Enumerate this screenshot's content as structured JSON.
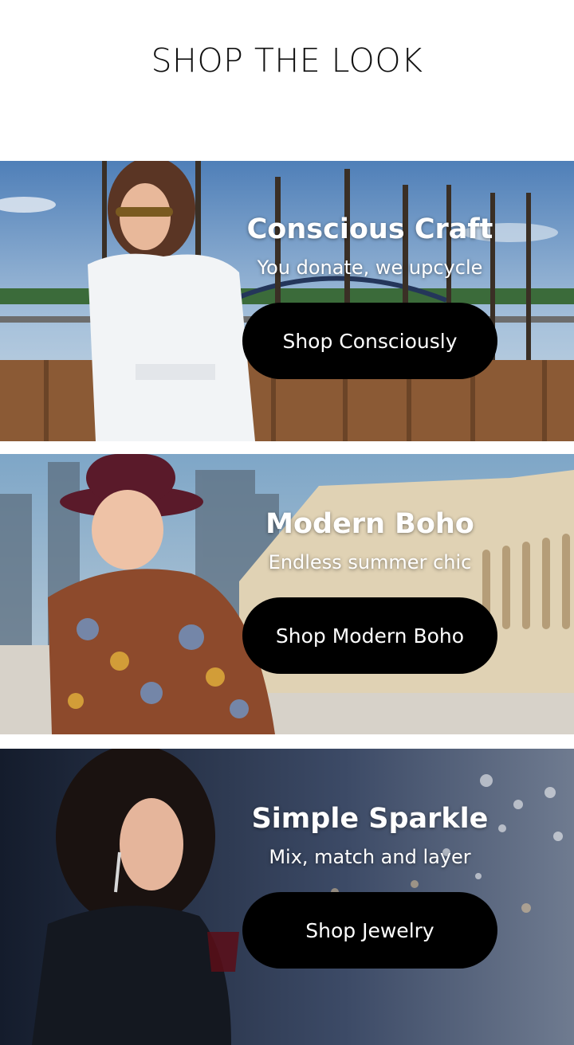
{
  "page": {
    "title": "SHOP THE LOOK"
  },
  "cards": [
    {
      "title": "Conscious Craft",
      "subtitle": "You donate, we upcycle",
      "button": "Shop Consciously"
    },
    {
      "title": "Modern Boho",
      "subtitle": "Endless summer chic",
      "button": "Shop Modern Boho"
    },
    {
      "title": "Simple Sparkle",
      "subtitle": "Mix, match and layer",
      "button": "Shop Jewelry"
    }
  ],
  "colors": {
    "button_bg": "#000000",
    "button_text": "#ffffff",
    "title_text": "#111111"
  }
}
